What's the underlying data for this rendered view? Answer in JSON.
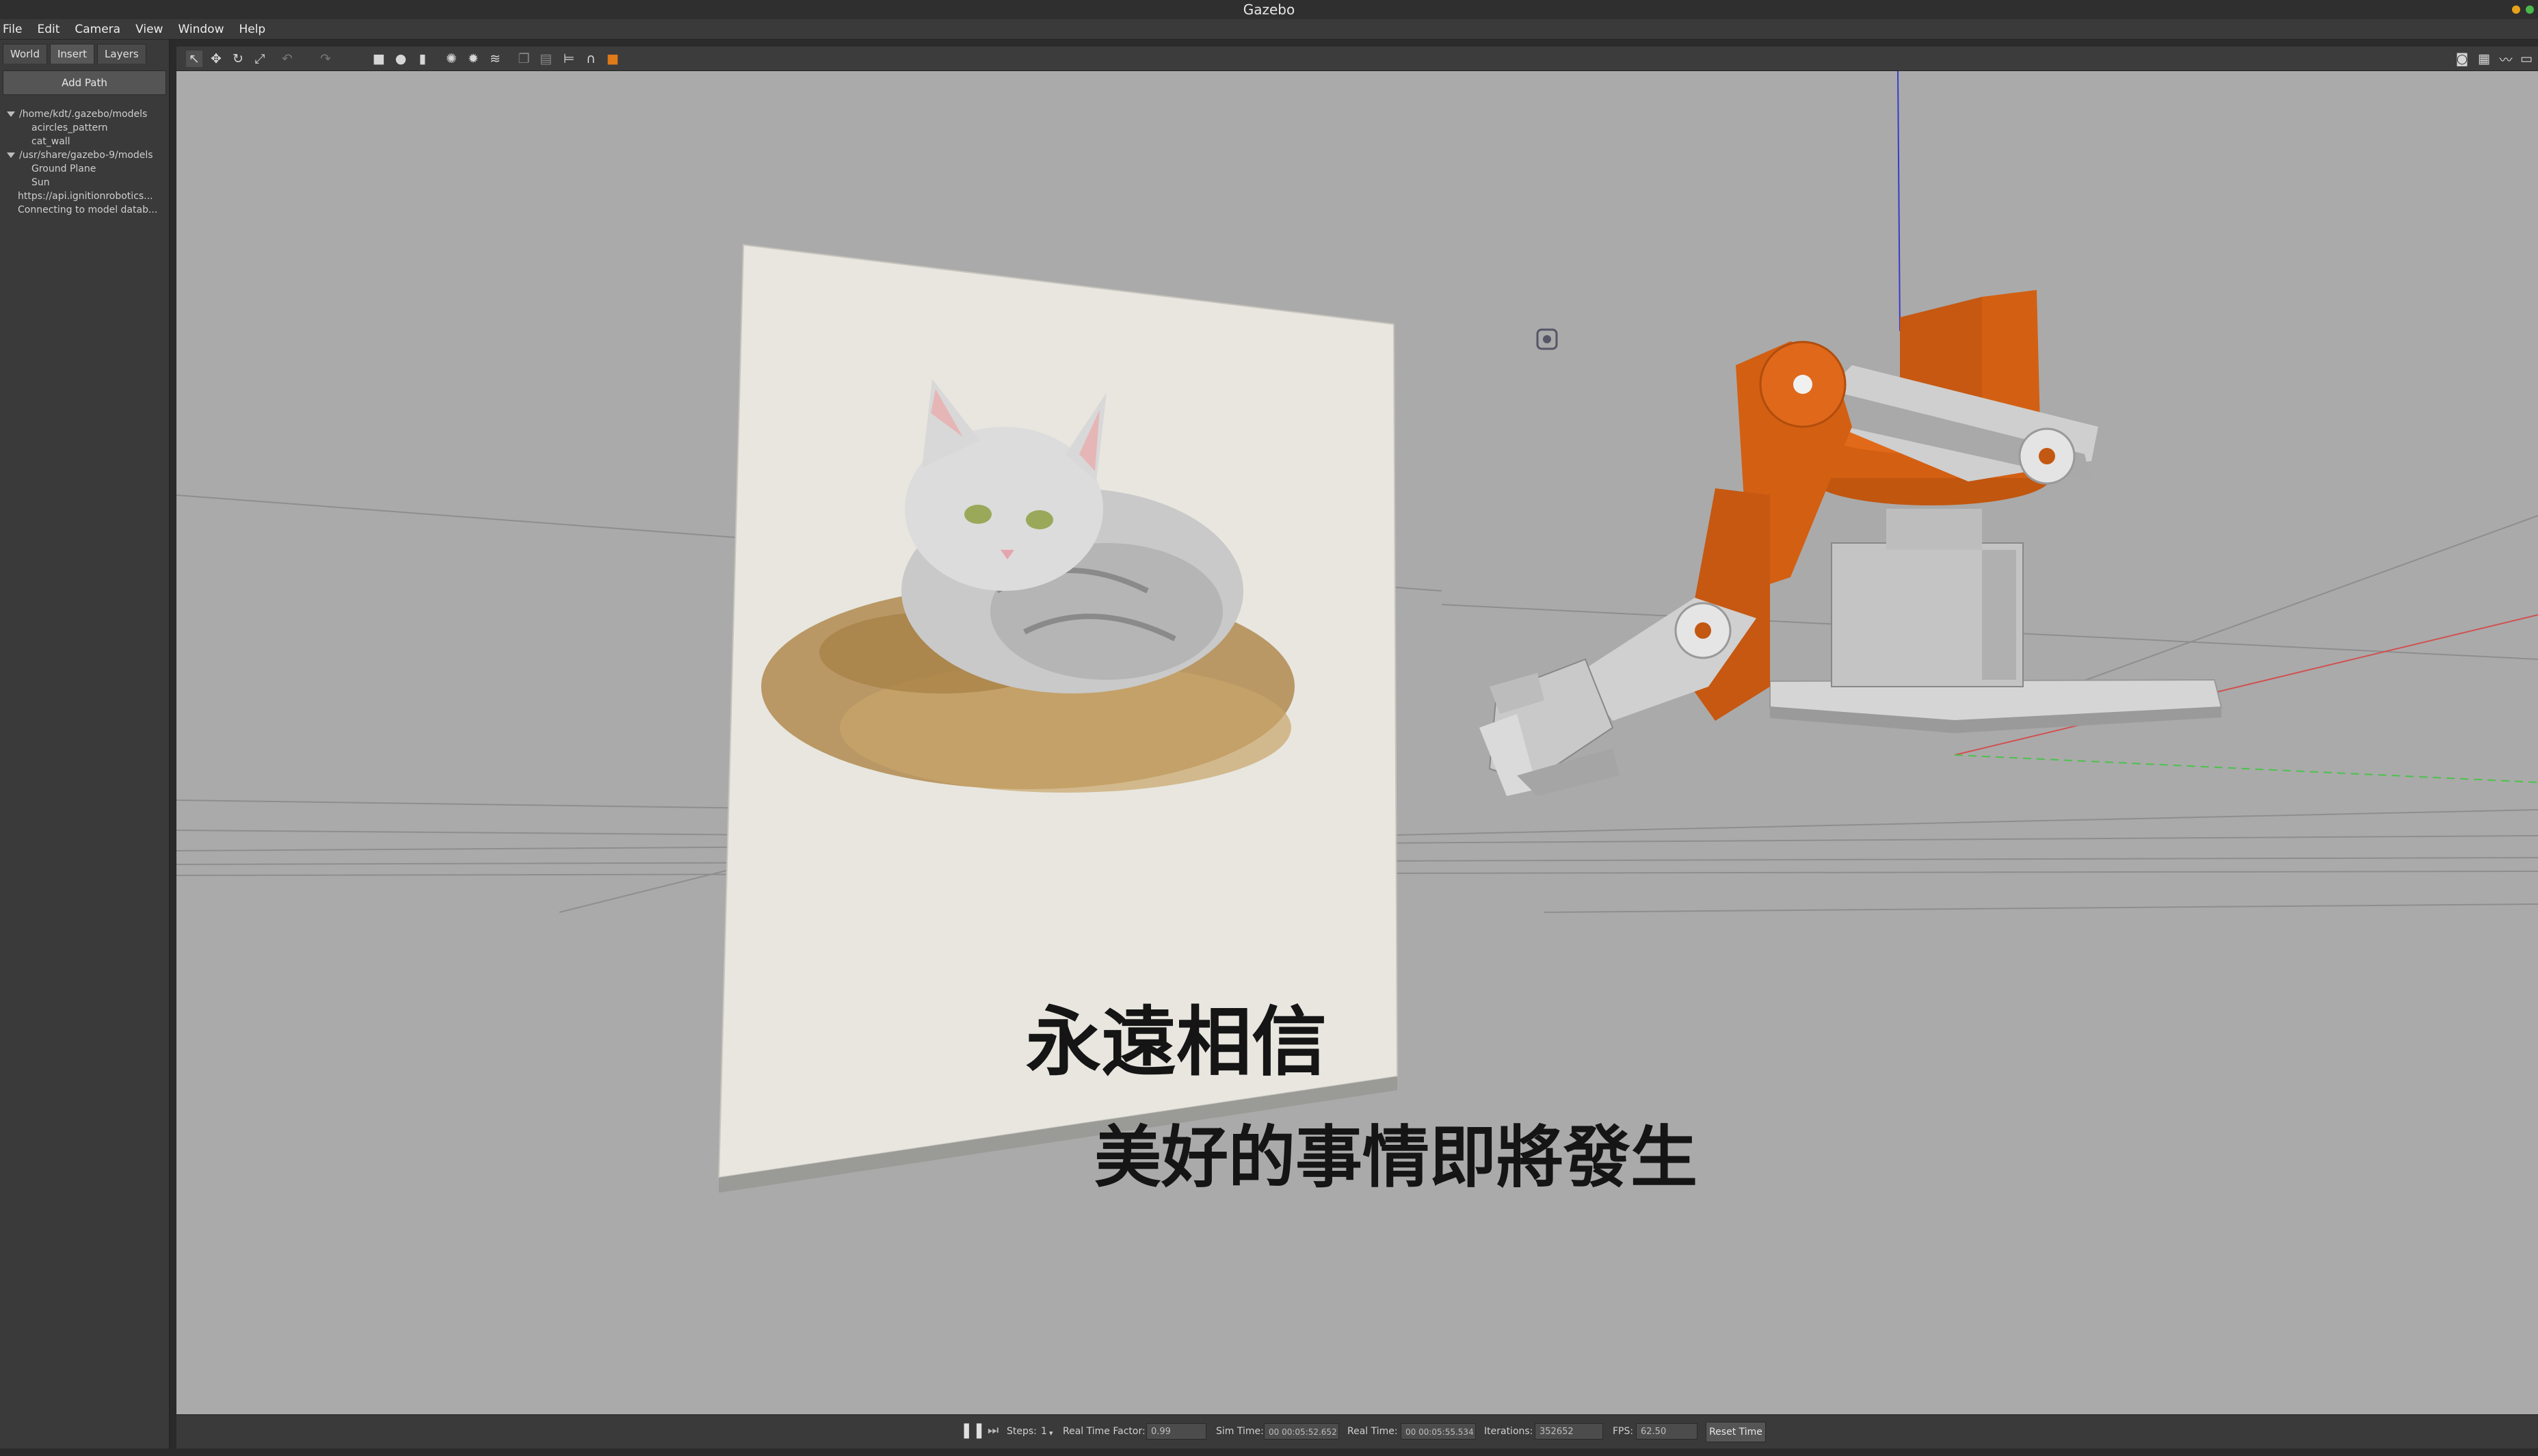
{
  "window": {
    "title": "Gazebo"
  },
  "menu": [
    "File",
    "Edit",
    "Camera",
    "View",
    "Window",
    "Help"
  ],
  "left_panel": {
    "tabs": [
      "World",
      "Insert",
      "Layers"
    ],
    "add_path_label": "Add Path",
    "tree": [
      {
        "label": "/home/kdt/.gazebo/models",
        "level": 0
      },
      {
        "label": "acircles_pattern",
        "level": 1
      },
      {
        "label": "cat_wall",
        "level": 1
      },
      {
        "label": "/usr/share/gazebo-9/models",
        "level": 0
      },
      {
        "label": "Ground Plane",
        "level": 1
      },
      {
        "label": "Sun",
        "level": 1
      },
      {
        "label": "https://api.ignitionrobotics...",
        "level": 2
      },
      {
        "label": "Connecting to model datab...",
        "level": 2
      }
    ]
  },
  "scene": {
    "poster_text_line1": "永遠相信",
    "poster_text_line2": "美好的事情即將發生",
    "arm_color": "#d35f13"
  },
  "bottom_bar": {
    "steps_label": "Steps:",
    "steps_value": "1",
    "rtf_label": "Real Time Factor:",
    "rtf_value": "0.99",
    "sim_time_label": "Sim Time:",
    "sim_time_value": "00 00:05:52.652",
    "real_time_label": "Real Time:",
    "real_time_value": "00 00:05:55.534",
    "iterations_label": "Iterations:",
    "iterations_value": "352652",
    "fps_label": "FPS:",
    "fps_value": "62.50",
    "reset_label": "Reset Time"
  }
}
